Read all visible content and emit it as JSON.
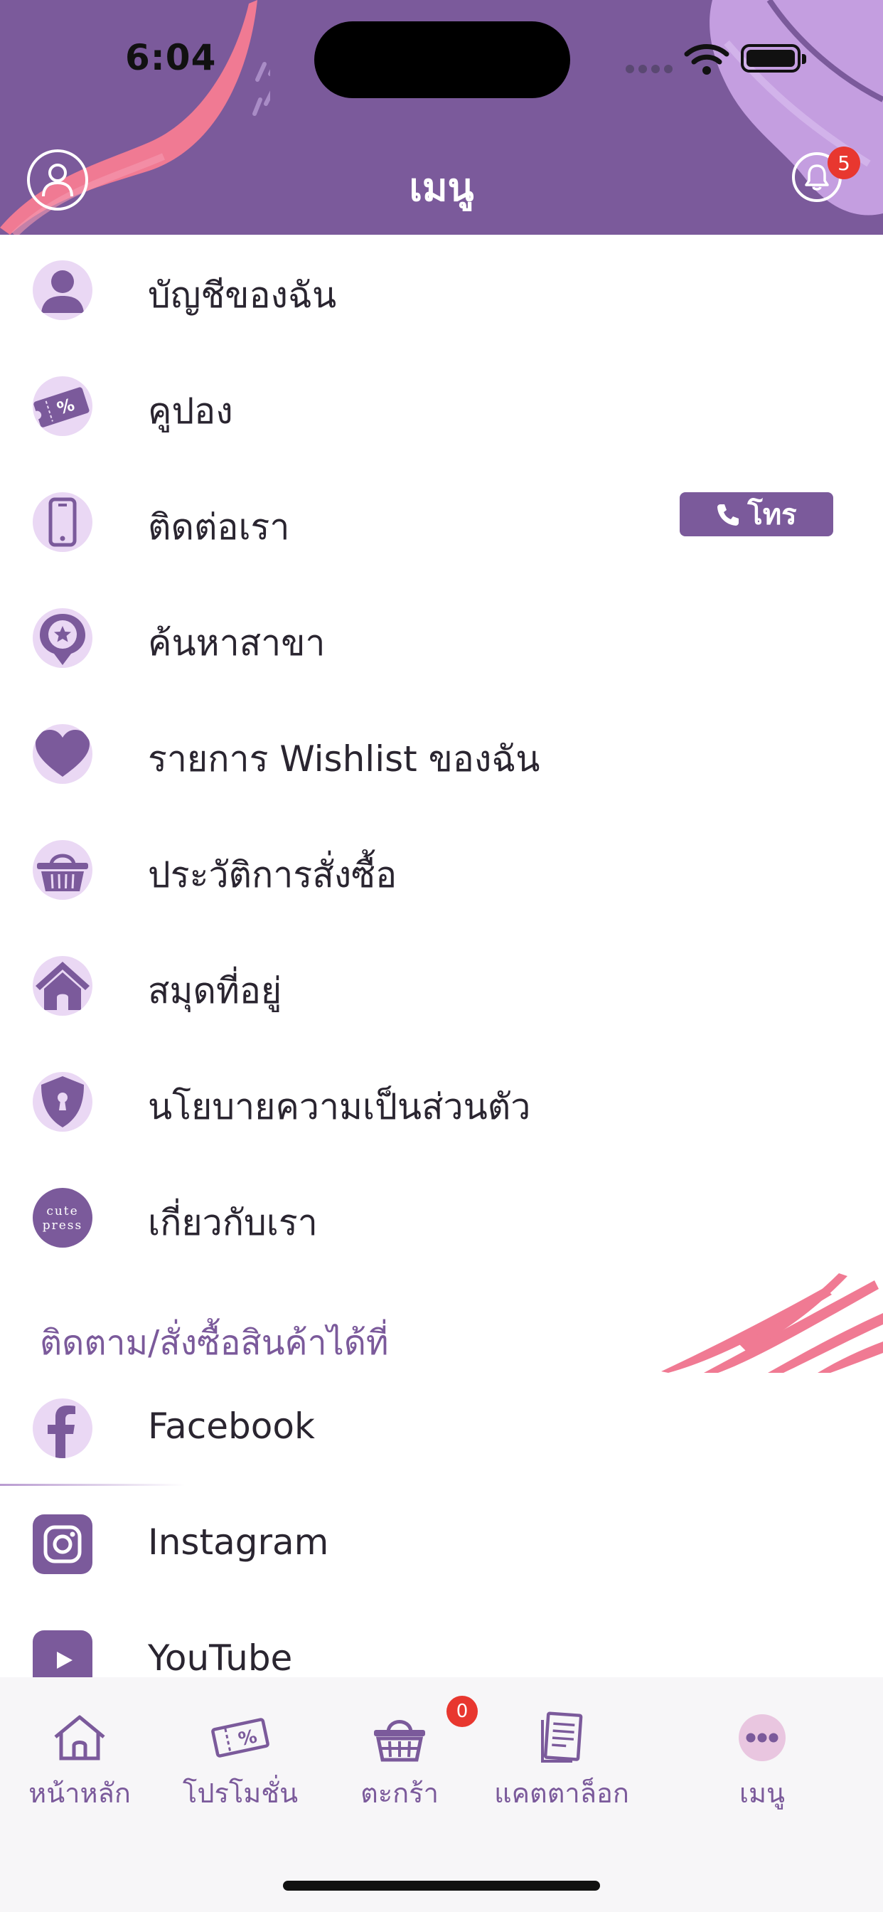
{
  "status_bar": {
    "time": "6:04"
  },
  "header": {
    "title": "เมนู",
    "notification_count": "5"
  },
  "menu": {
    "items": [
      {
        "label": "บัญชีของฉัน",
        "icon": "user-icon"
      },
      {
        "label": "คูปอง",
        "icon": "coupon-icon"
      },
      {
        "label": "ติดต่อเรา",
        "icon": "phone-icon",
        "action_label": "โทร"
      },
      {
        "label": "ค้นหาสาขา",
        "icon": "location-pin-icon"
      },
      {
        "label": "รายการ Wishlist ของฉัน",
        "icon": "heart-icon"
      },
      {
        "label": "ประวัติการสั่งซื้อ",
        "icon": "basket-icon"
      },
      {
        "label": "สมุดที่อยู่",
        "icon": "house-icon"
      },
      {
        "label": "นโยบายความเป็นส่วนตัว",
        "icon": "shield-lock-icon"
      },
      {
        "label": "เกี่ยวกับเรา",
        "icon": "cute-press-logo",
        "logo_text_1": "cute",
        "logo_text_2": "press"
      }
    ],
    "social_title": "ติดตาม/สั่งซื้อสินค้าได้ที่",
    "social": [
      {
        "label": "Facebook",
        "icon": "facebook-icon"
      },
      {
        "label": "Instagram",
        "icon": "instagram-icon"
      },
      {
        "label": "YouTube",
        "icon": "youtube-icon"
      }
    ]
  },
  "tabbar": {
    "tabs": [
      {
        "label": "หน้าหลัก",
        "icon": "home-icon"
      },
      {
        "label": "โปรโมชั่น",
        "icon": "promotion-ticket-icon"
      },
      {
        "label": "ตะกร้า",
        "icon": "cart-icon",
        "badge": "0"
      },
      {
        "label": "แคตตาล็อก",
        "icon": "catalog-icon"
      },
      {
        "label": "เมนู",
        "icon": "more-dots-icon"
      }
    ]
  },
  "colors": {
    "brand": "#7b5a9b",
    "icon_bg": "#ead8f4",
    "accent_pink": "#f07a93",
    "badge": "#e8372f"
  }
}
